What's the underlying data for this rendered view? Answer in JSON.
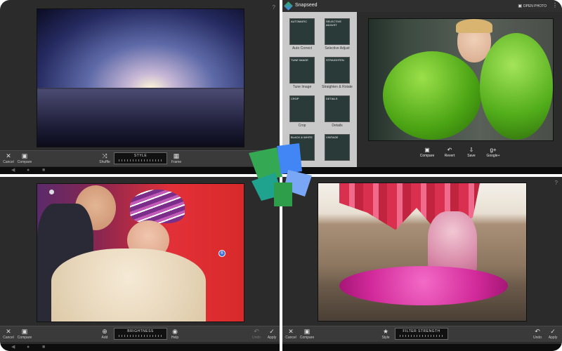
{
  "top_left": {
    "help": "?",
    "toolbar": {
      "cancel": "Cancel",
      "compare": "Compare",
      "shuffle": "Shuffle",
      "frame": "Frame",
      "style_label": "STYLE"
    }
  },
  "top_right": {
    "app_name": "Snapseed",
    "open_photo": "OPEN PHOTO",
    "tools": [
      {
        "thumb": "AUTOMATIC",
        "label": "Auto Correct"
      },
      {
        "thumb": "SELECTIVE ADJUST",
        "label": "Selective Adjust"
      },
      {
        "thumb": "TUNE IMAGE",
        "label": "Tune Image"
      },
      {
        "thumb": "STRAIGHTEN",
        "label": "Straighten & Rotate"
      },
      {
        "thumb": "CROP",
        "label": "Crop"
      },
      {
        "thumb": "DETAILS",
        "label": "Details"
      },
      {
        "thumb": "BLACK & WHITE",
        "label": ""
      },
      {
        "thumb": "VINTAGE",
        "label": ""
      }
    ],
    "actions": {
      "compare": "Compare",
      "revert": "Revert",
      "save": "Save",
      "google": "Google+"
    }
  },
  "bottom_left": {
    "toolbar": {
      "cancel": "Cancel",
      "compare": "Compare",
      "add": "Add",
      "help": "Help",
      "undo": "Undo",
      "apply": "Apply",
      "brightness_label": "BRIGHTNESS"
    },
    "pin_label": "B"
  },
  "bottom_right": {
    "help": "?",
    "toolbar": {
      "cancel": "Cancel",
      "compare": "Compare",
      "style": "Style",
      "undo": "Undo",
      "apply": "Apply",
      "filter_label": "FILTER STRENGTH"
    }
  },
  "colors": {
    "logo_green": "#34a853",
    "logo_teal": "#1fa38f",
    "logo_blue": "#4285f4",
    "logo_lightblue": "#7aa7f5",
    "lips_red": "#e02020"
  }
}
